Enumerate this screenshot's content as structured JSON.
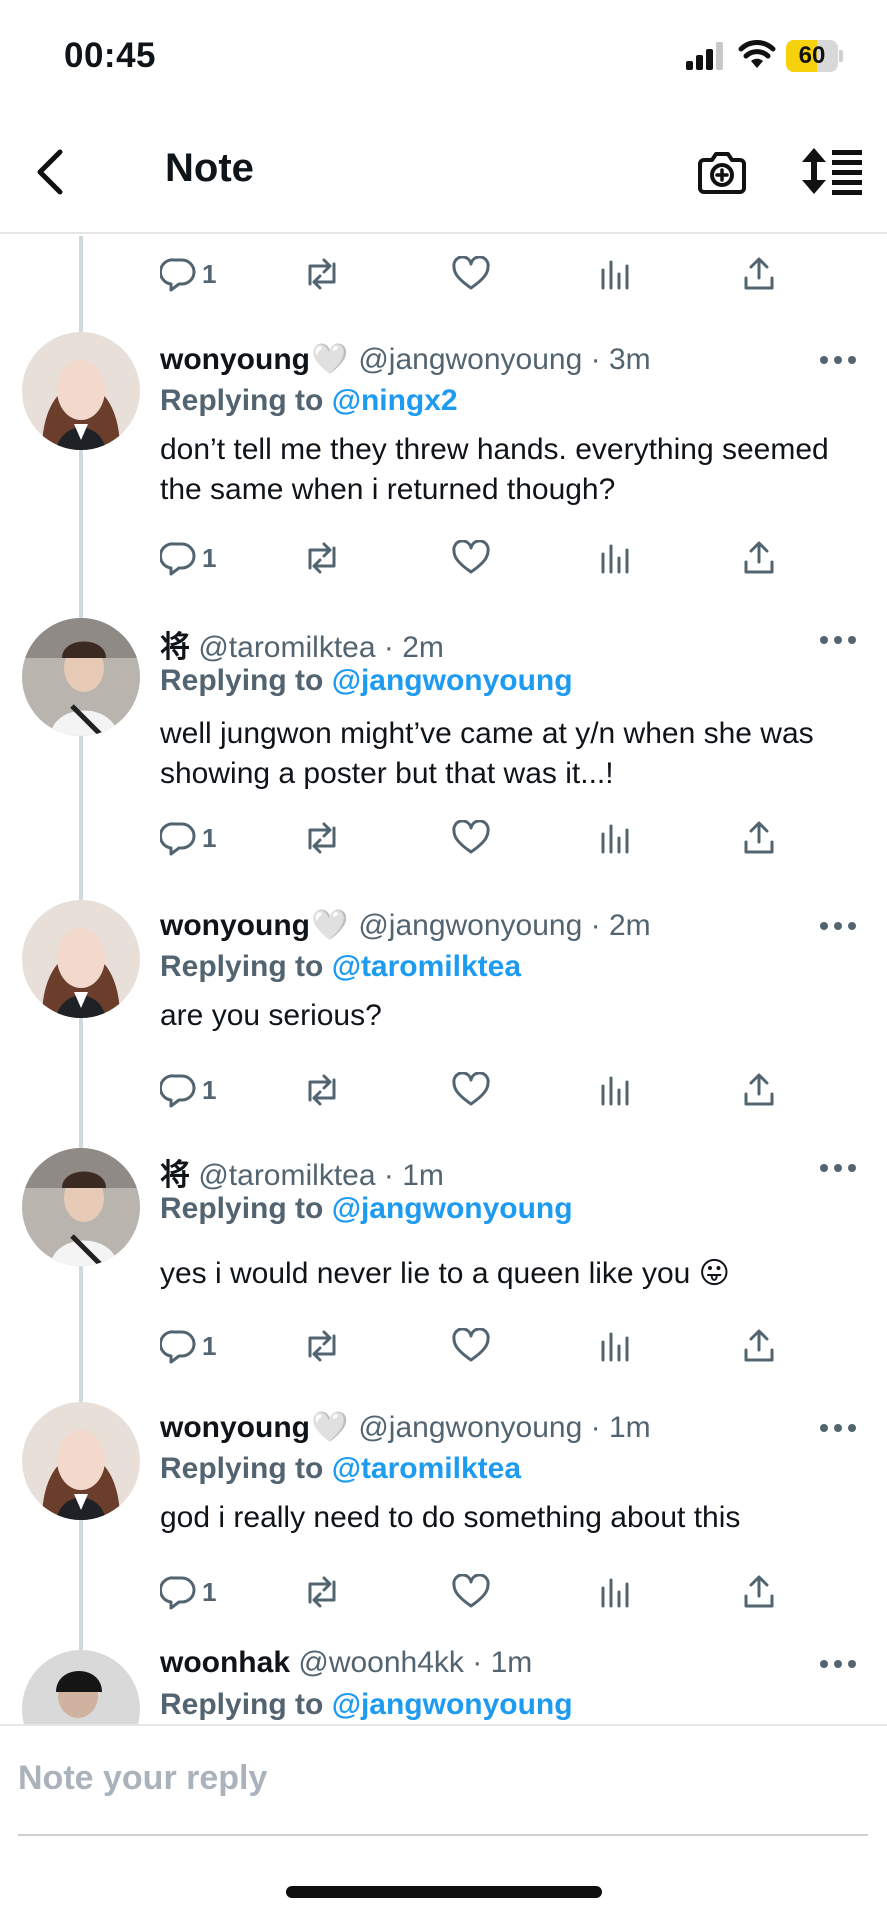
{
  "status_bar": {
    "time": "00:45",
    "battery_level": "60",
    "battery_fraction": 0.6
  },
  "header": {
    "title": "Note"
  },
  "actions_template": {
    "reply_count": "1"
  },
  "posts": [
    {
      "author_name": "wonyoung",
      "name_badge": "🤍",
      "handle": "@jangwonyoung",
      "time": "· 3m",
      "replying_label": "Replying to",
      "replying_to": "@ningx2",
      "text": "don’t tell me they threw hands. everything seemed the same when i returned though?",
      "reply_count": "1"
    },
    {
      "author_name": "将",
      "handle": "@taromilktea",
      "time": "· 2m",
      "replying_label": "Replying to",
      "replying_to": "@jangwonyoung",
      "text": "well jungwon might’ve came at y/n when she was showing a poster but that was it...!",
      "reply_count": "1"
    },
    {
      "author_name": "wonyoung",
      "name_badge": "🤍",
      "handle": "@jangwonyoung",
      "time": "· 2m",
      "replying_label": "Replying to",
      "replying_to": "@taromilktea",
      "text": "are you serious?",
      "reply_count": "1"
    },
    {
      "author_name": "将",
      "handle": "@taromilktea",
      "time": "· 1m",
      "replying_label": "Replying to",
      "replying_to": "@jangwonyoung",
      "text": "yes i would never lie to a queen like you 😛",
      "reply_count": "1"
    },
    {
      "author_name": "wonyoung",
      "name_badge": "🤍",
      "handle": "@jangwonyoung",
      "time": "· 1m",
      "replying_label": "Replying to",
      "replying_to": "@taromilktea",
      "text": "god i really need to do something about this",
      "reply_count": "1"
    },
    {
      "author_name": "woonhak",
      "handle": "@woonh4kk",
      "time": "· 1m",
      "replying_label": "Replying to",
      "replying_to": "@jangwonyoung"
    }
  ],
  "reply_bar": {
    "placeholder": "Note your reply"
  },
  "colors": {
    "accent": "#1d9bf0",
    "muted": "#536471",
    "text": "#0f1419",
    "battery": "#f5d20b"
  }
}
